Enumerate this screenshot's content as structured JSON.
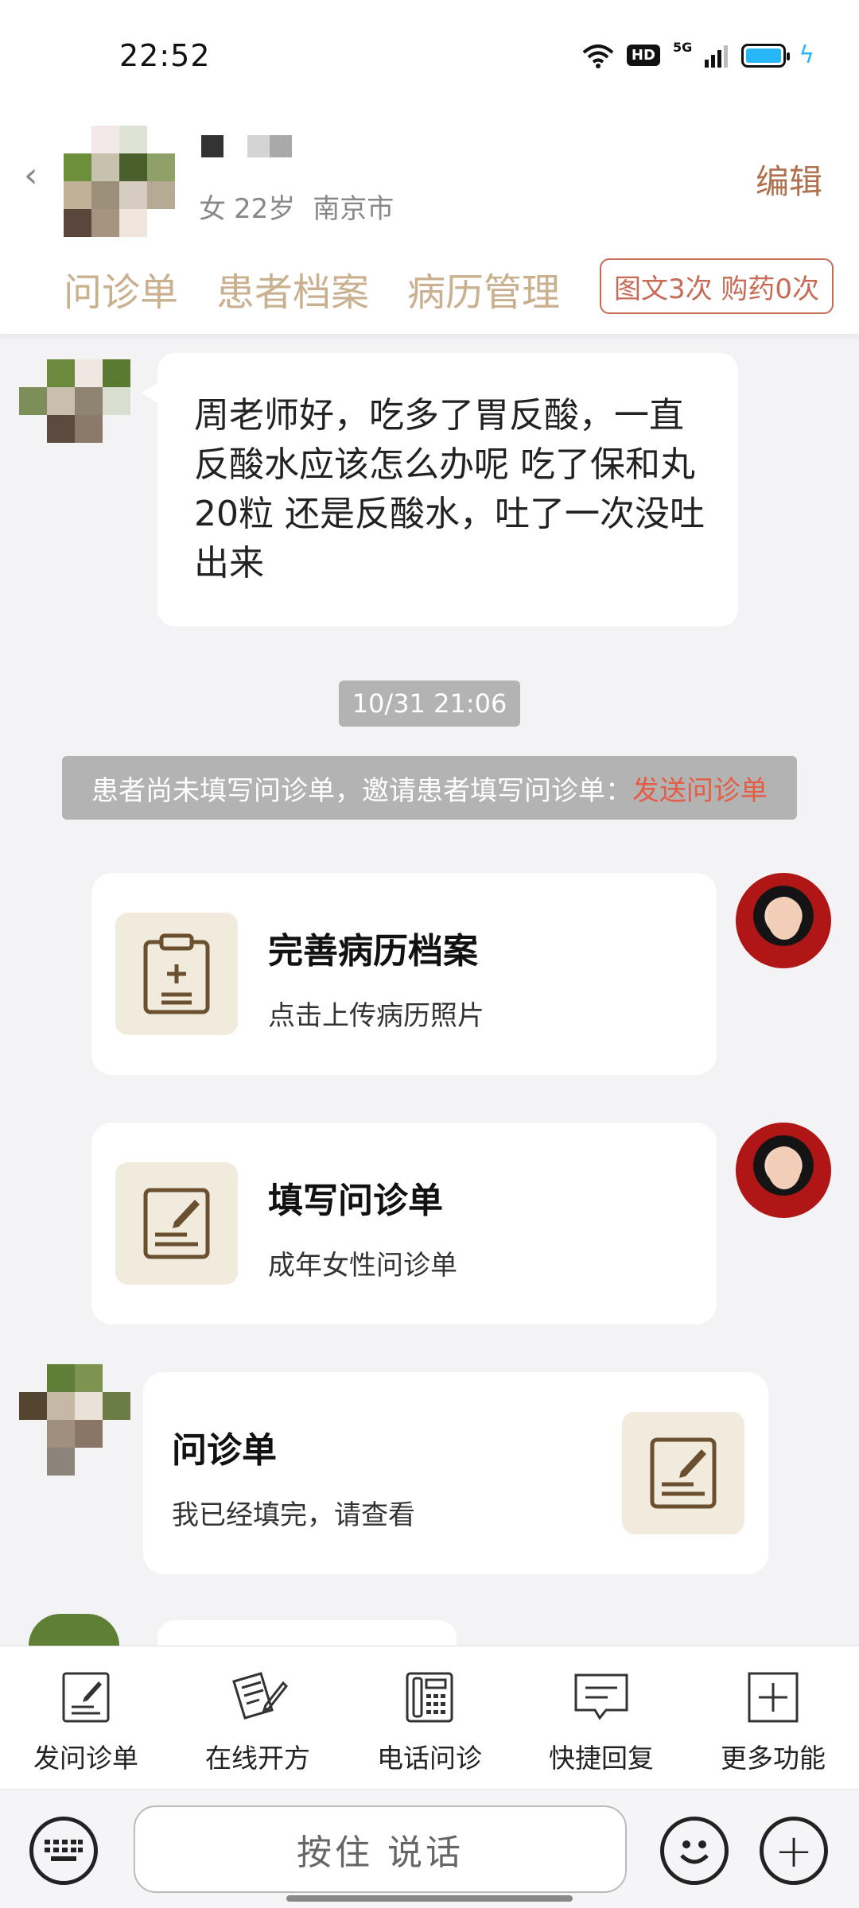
{
  "status_bar": {
    "time": "22:52",
    "hd": "HD",
    "network": "5G"
  },
  "header": {
    "gender": "女",
    "age": "22岁",
    "city": "南京市",
    "edit_label": "编辑",
    "tabs": [
      {
        "label": "问诊单"
      },
      {
        "label": "患者档案"
      },
      {
        "label": "病历管理"
      }
    ],
    "usage_badge": "图文3次 购药0次"
  },
  "messages": {
    "patient_question": "周老师好，吃多了胃反酸，一直反酸水应该怎么办呢 吃了保和丸20粒 还是反酸水，吐了一次没吐出来",
    "timestamp": "10/31 21:06",
    "notice_text": "患者尚未填写问诊单，邀请患者填写问诊单：",
    "notice_link": "发送问诊单",
    "card_records": {
      "title": "完善病历档案",
      "subtitle": "点击上传病历照片"
    },
    "card_form": {
      "title": "填写问诊单",
      "subtitle": "成年女性问诊单"
    },
    "card_reply": {
      "title": "问诊单",
      "subtitle": "我已经填完，请查看"
    }
  },
  "toolbar": {
    "items": [
      {
        "label": "发问诊单",
        "icon": "form-icon"
      },
      {
        "label": "在线开方",
        "icon": "prescription-icon"
      },
      {
        "label": "电话问诊",
        "icon": "phone-icon"
      },
      {
        "label": "快捷回复",
        "icon": "quick-reply-icon"
      },
      {
        "label": "更多功能",
        "icon": "more-icon"
      }
    ]
  },
  "input_bar": {
    "voice_label": "按住 说话"
  },
  "colors": {
    "accent": "#c9b08f",
    "edit": "#b0714f",
    "link": "#e35e45",
    "badge_border": "#c66b55",
    "icon_bg": "#f1ebdd",
    "icon_stroke": "#6b5030"
  }
}
